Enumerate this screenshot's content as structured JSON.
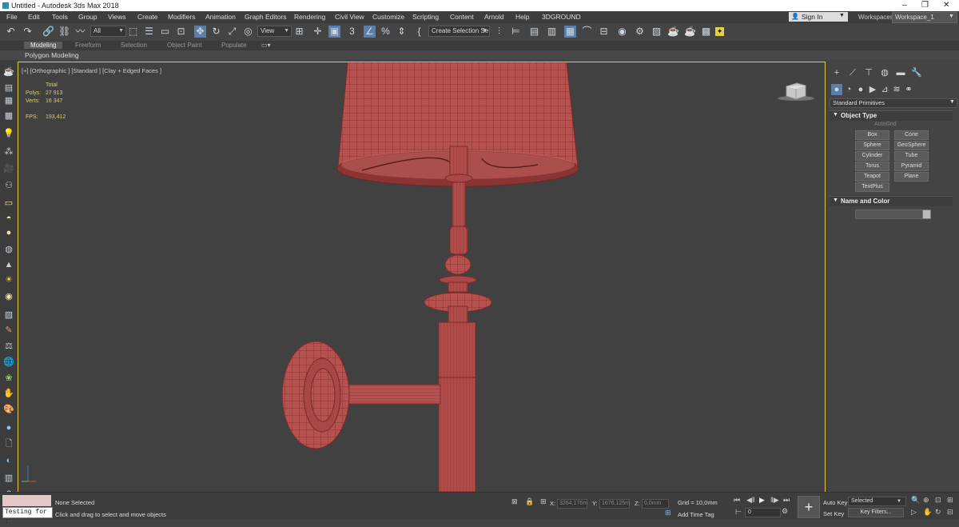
{
  "app": {
    "title": "Untitled - Autodesk 3ds Max 2018"
  },
  "menu": [
    "File",
    "Edit",
    "Tools",
    "Group",
    "Views",
    "Create",
    "Modifiers",
    "Animation",
    "Graph Editors",
    "Rendering",
    "Civil View",
    "Customize",
    "Scripting",
    "Content",
    "Arnold",
    "Help",
    "3DGROUND"
  ],
  "account": {
    "signin": "Sign In",
    "workspaces_label": "Workspaces:",
    "workspace": "Workspace_1"
  },
  "toolbar": {
    "filter": "All",
    "refcoord": "View",
    "selection_set": "Create Selection Se"
  },
  "ribbon": {
    "tabs": [
      "Modeling",
      "Freeform",
      "Selection",
      "Object Paint",
      "Populate"
    ],
    "active": "Modeling",
    "sub": "Polygon Modeling"
  },
  "viewport": {
    "label": "[+] [Orthographic ] [Standard ] [Clay + Edged Faces ]",
    "stats": {
      "total": "Total",
      "polys_label": "Polys:",
      "polys": "27 913",
      "verts_label": "Verts:",
      "verts": "16 347",
      "fps_label": "FPS:",
      "fps": "193,412"
    },
    "mesh_color": "#b5514f",
    "wire_color": "#7a2a28"
  },
  "command_panel": {
    "primitive_type": "Standard Primitives",
    "object_type_header": "Object Type",
    "autogrid": "AutoGrid",
    "buttons": [
      "Box",
      "Cone",
      "Sphere",
      "GeoSphere",
      "Cylinder",
      "Tube",
      "Torus",
      "Pyramid",
      "Teapot",
      "Plane",
      "TextPlus"
    ],
    "name_color_header": "Name and Color"
  },
  "status": {
    "none_selected": "None Selected",
    "prompt": "Click and drag to select and move objects",
    "script_input": "Testing for :",
    "x_label": "X:",
    "x": "3264,176m",
    "y_label": "Y:",
    "y": "1676,125m",
    "z_label": "Z:",
    "z": "0,0mm",
    "grid": "Grid = 10,0mm",
    "add_time_tag": "Add Time Tag",
    "frame": "0",
    "auto_key": "Auto Key",
    "set_key": "Set Key",
    "key_mode": "Selected",
    "key_filters": "Key Filters..."
  }
}
